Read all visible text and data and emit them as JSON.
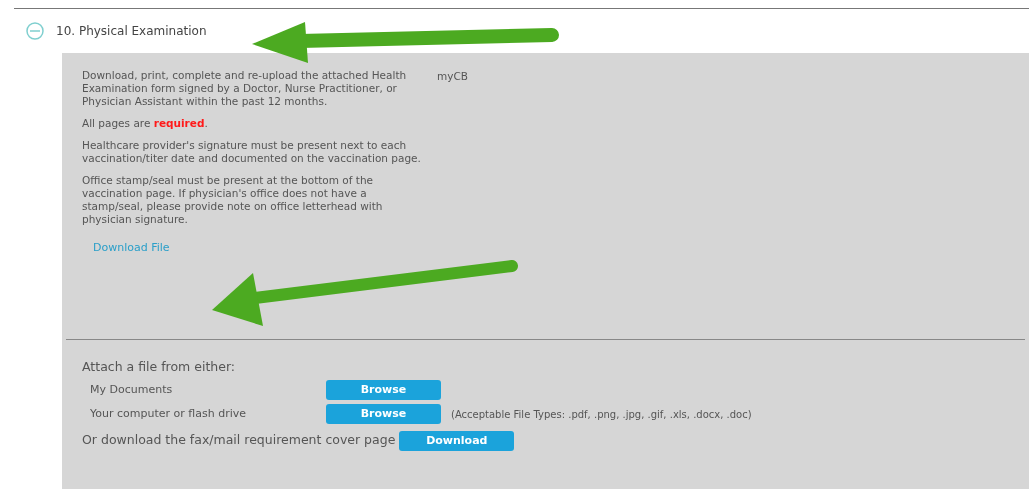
{
  "section": {
    "title": "10. Physical Examination",
    "expanded": true
  },
  "instructions": {
    "paragraphs": [
      "Download, print, complete and re-upload the attached Health Examination form signed by a Doctor, Nurse Practitioner, or Physician Assistant within the past 12 months.",
      "All pages are **required**.",
      "Healthcare provider's signature must be present next to each vaccination/titer date and documented on the vaccination page.",
      "Office stamp/seal must be present at the bottom of the vaccination page. If physician's office does not have a stamp/seal, please provide note on office letterhead with physician signature."
    ],
    "link": "Download File",
    "side_label": "myCB"
  },
  "attach": {
    "heading": "Attach a file from either:",
    "sources": [
      {
        "label": "My Documents",
        "button": "Browse"
      },
      {
        "label": "Your computer or flash drive",
        "button": "Browse",
        "note": "(Acceptable File Types: .pdf, .png, .jpg, .gif, .xls, .docx, .doc)"
      }
    ],
    "cover_label": "Or download the fax/mail requirement cover page",
    "cover_button": "Download"
  }
}
